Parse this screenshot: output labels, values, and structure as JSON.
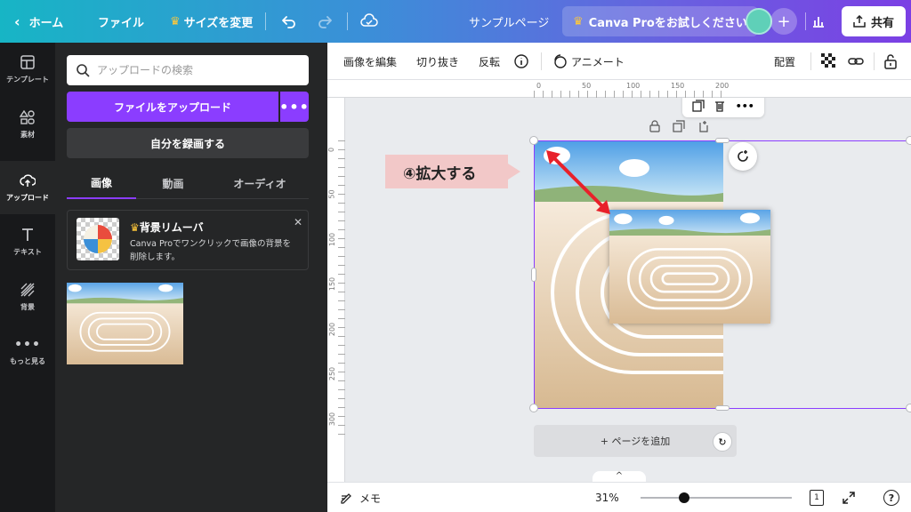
{
  "topbar": {
    "home_label": "ホーム",
    "file_label": "ファイル",
    "resize_label": "サイズを変更",
    "page_title": "サンプルページ",
    "pro_label": "Canva Proをお試しください",
    "share_label": "共有"
  },
  "rail": {
    "items": [
      {
        "label": "テンプレート",
        "icon": "layout-icon"
      },
      {
        "label": "素材",
        "icon": "shapes-icon"
      },
      {
        "label": "アップロード",
        "icon": "cloud-upload-icon"
      },
      {
        "label": "テキスト",
        "icon": "text-icon"
      },
      {
        "label": "背景",
        "icon": "background-icon"
      },
      {
        "label": "もっと見る",
        "icon": "more-icon"
      }
    ]
  },
  "panel": {
    "search_placeholder": "アップロードの検索",
    "upload_label": "ファイルをアップロード",
    "record_label": "自分を録画する",
    "tabs": [
      "画像",
      "動画",
      "オーディオ"
    ],
    "bg_remover": {
      "title": "背景リムーバ",
      "desc": "Canva Proでワンクリックで画像の背景を削除します。"
    }
  },
  "toolbar": {
    "edit_image": "画像を編集",
    "crop": "切り抜き",
    "flip": "反転",
    "animate": "アニメート",
    "position": "配置"
  },
  "ruler": {
    "top_ticks": [
      "0",
      "50",
      "100",
      "150",
      "200"
    ],
    "left_ticks": [
      "0",
      "50",
      "100",
      "150",
      "200",
      "250",
      "300"
    ]
  },
  "canvas": {
    "callout": "④拡大する",
    "add_page": "+ ページを追加"
  },
  "bottombar": {
    "notes": "メモ",
    "zoom": "31%",
    "page_count": "1"
  },
  "colors": {
    "accent": "#8b3dff",
    "arrow": "#e8212a"
  }
}
